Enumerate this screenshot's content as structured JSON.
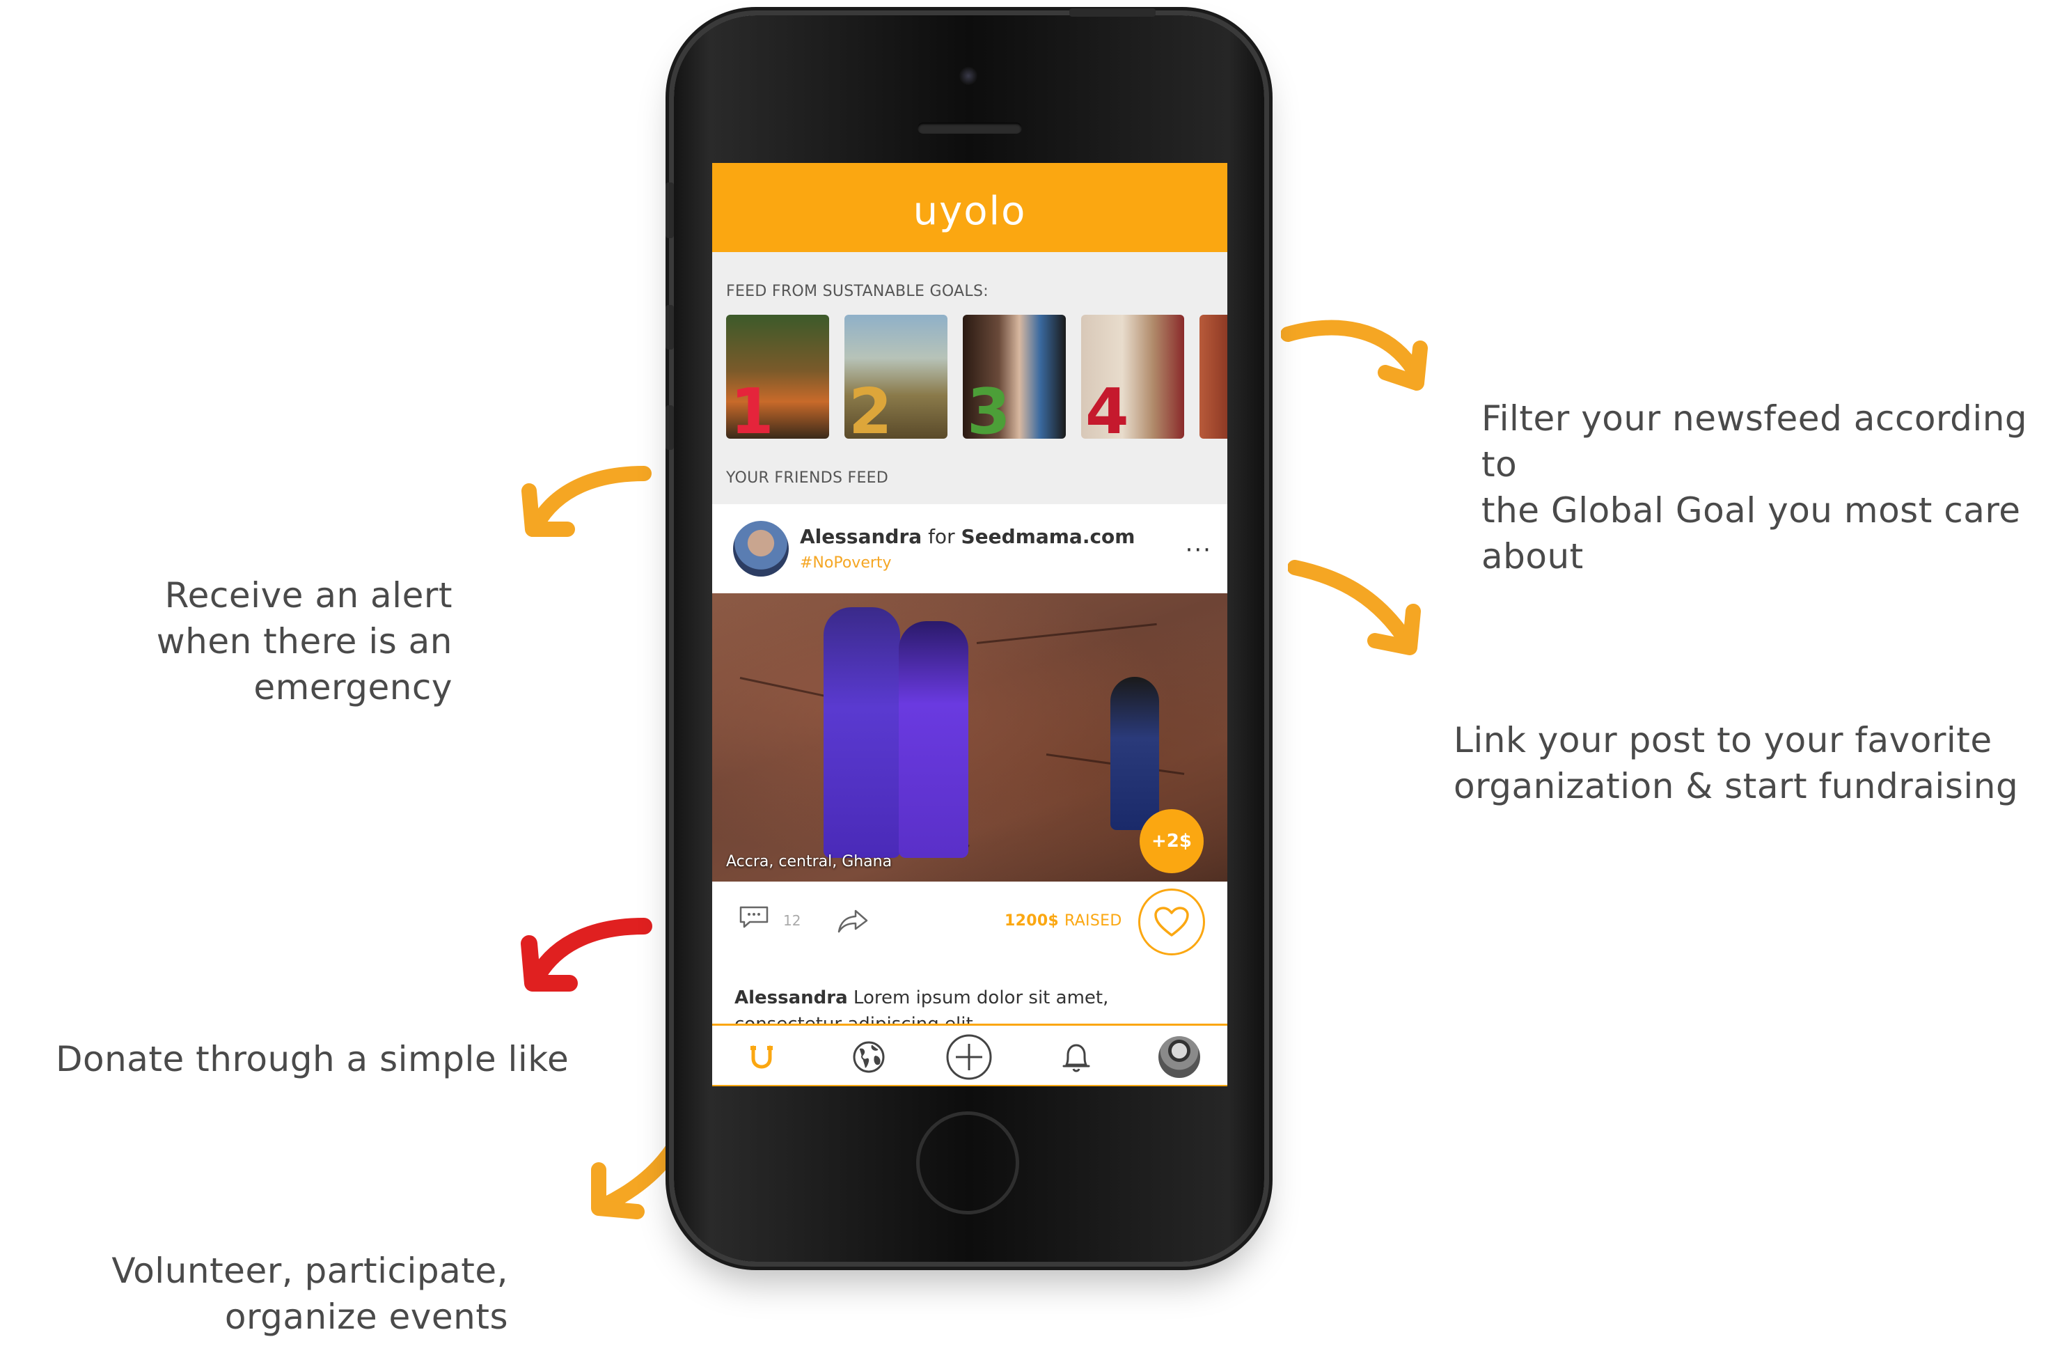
{
  "annotations": {
    "filter": [
      "Filter your newsfeed according to",
      "the Global Goal you most care about"
    ],
    "alert": [
      "Receive an alert",
      "when there is an emergency"
    ],
    "link": [
      "Link your post to your favorite",
      "organization & start fundraising"
    ],
    "donate": [
      "Donate through a simple like"
    ],
    "volunteer": [
      "Volunteer, participate,",
      "organize events"
    ]
  },
  "colors": {
    "accent": "#fba711",
    "alert_arrow": "#e02020",
    "arrow": "#f5a623"
  },
  "app": {
    "brand": "uyolo",
    "goals_label": "FEED FROM SUSTANABLE GOALS:",
    "friends_label": "YOUR FRIENDS FEED",
    "goals": [
      {
        "num": "1",
        "color": "#e5243b"
      },
      {
        "num": "2",
        "color": "#dda63a"
      },
      {
        "num": "3",
        "color": "#4c9f38"
      },
      {
        "num": "4",
        "color": "#c5192d"
      }
    ],
    "post": {
      "author": "Alessandra",
      "for_word": "for",
      "org": "Seedmama.com",
      "hashtag": "#NoPoverty",
      "more": "···",
      "location": "Accra, central, Ghana",
      "badge": "+2$",
      "comment_count": "12",
      "raised_amount": "1200$",
      "raised_word": "RAISED",
      "caption_author": "Alessandra",
      "caption_text": " Lorem ipsum dolor sit amet, consectetur adipiscing elit"
    },
    "tabs": [
      "home-icon",
      "globe-icon",
      "add-icon",
      "bell-icon",
      "profile-avatar"
    ]
  }
}
